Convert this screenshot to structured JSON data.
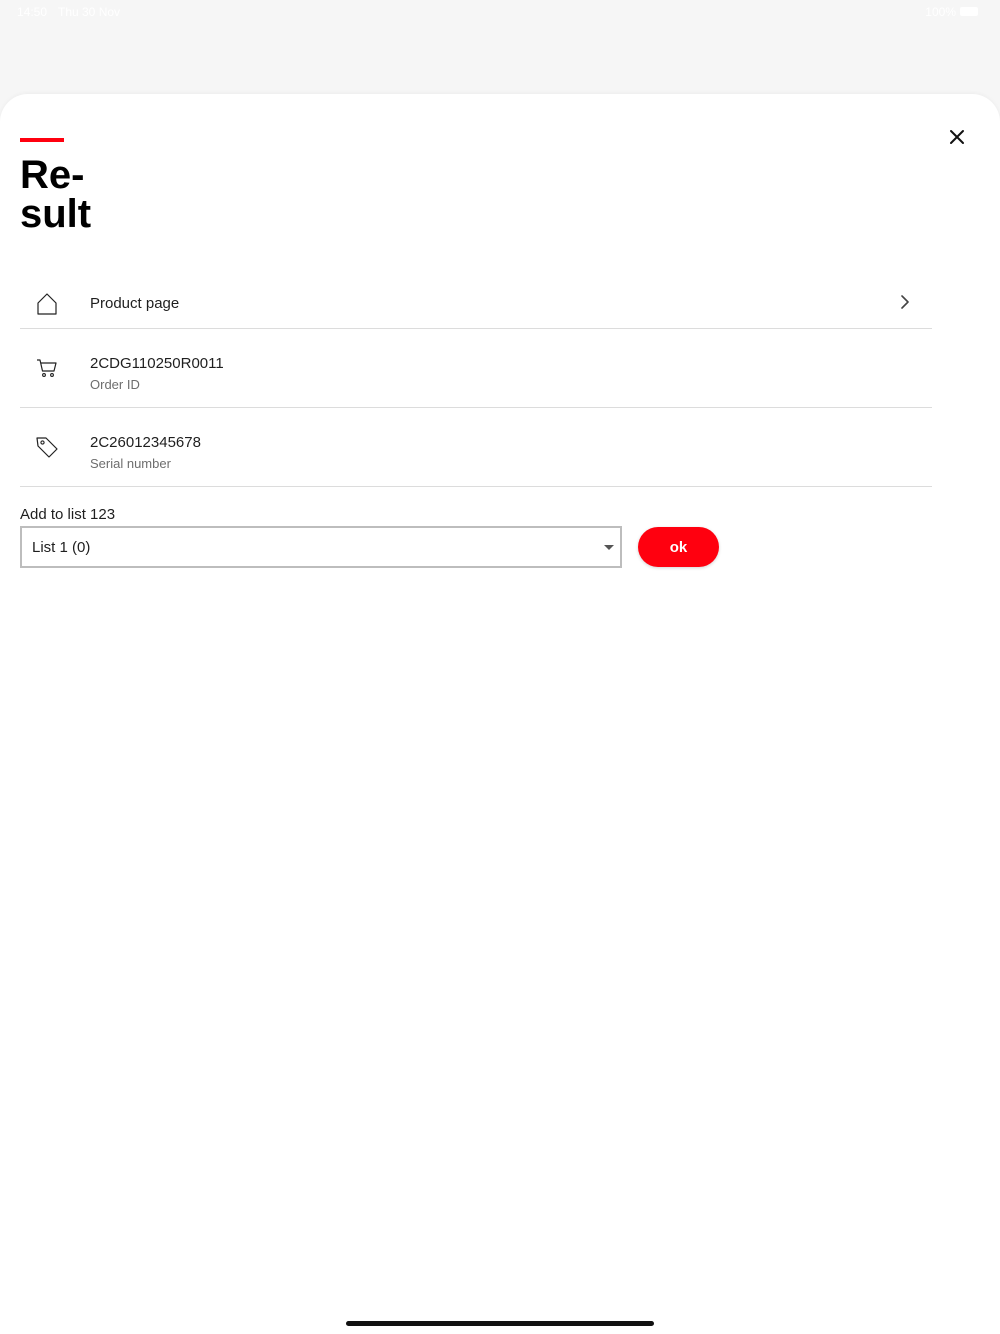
{
  "status_bar": {
    "time": "14:50",
    "date": "Thu 30 Nov",
    "battery": "100%"
  },
  "sheet": {
    "title": "Re-\nsult",
    "accent_color": "#ff000f"
  },
  "rows": [
    {
      "label": "Product page",
      "icon": "home-icon"
    },
    {
      "value": "2CDG110250R0011",
      "sub": "Order ID",
      "icon": "cart-icon"
    },
    {
      "value": "2C26012345678",
      "sub": "Serial number",
      "icon": "tag-icon"
    }
  ],
  "add_to_list": {
    "label": "Add to list 123",
    "selected": "List 1 (0)",
    "button": "ok"
  }
}
